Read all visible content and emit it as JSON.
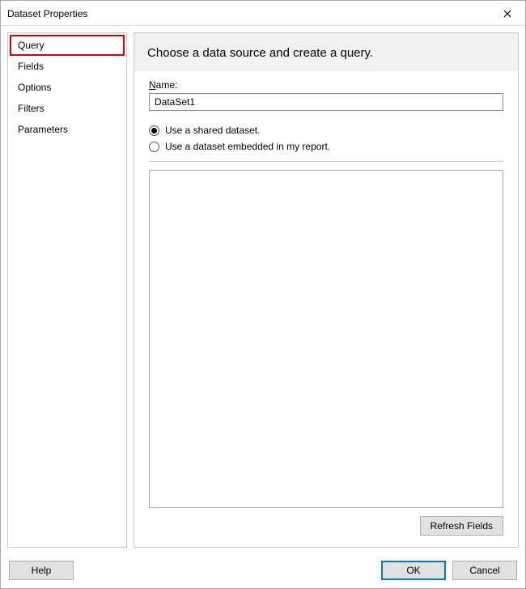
{
  "titlebar": {
    "title": "Dataset Properties"
  },
  "sidebar": {
    "items": [
      {
        "label": "Query",
        "selected": true
      },
      {
        "label": "Fields",
        "selected": false
      },
      {
        "label": "Options",
        "selected": false
      },
      {
        "label": "Filters",
        "selected": false
      },
      {
        "label": "Parameters",
        "selected": false
      }
    ]
  },
  "main": {
    "heading": "Choose a data source and create a query.",
    "name_label_prefix": "N",
    "name_label_rest": "ame:",
    "name_value": "DataSet1",
    "radio_shared": "Use a shared dataset.",
    "radio_embedded": "Use a dataset embedded in my report.",
    "selected_radio": "shared",
    "refresh_label": "Refresh Fields"
  },
  "footer": {
    "help_label": "Help",
    "ok_label": "OK",
    "cancel_label": "Cancel"
  }
}
